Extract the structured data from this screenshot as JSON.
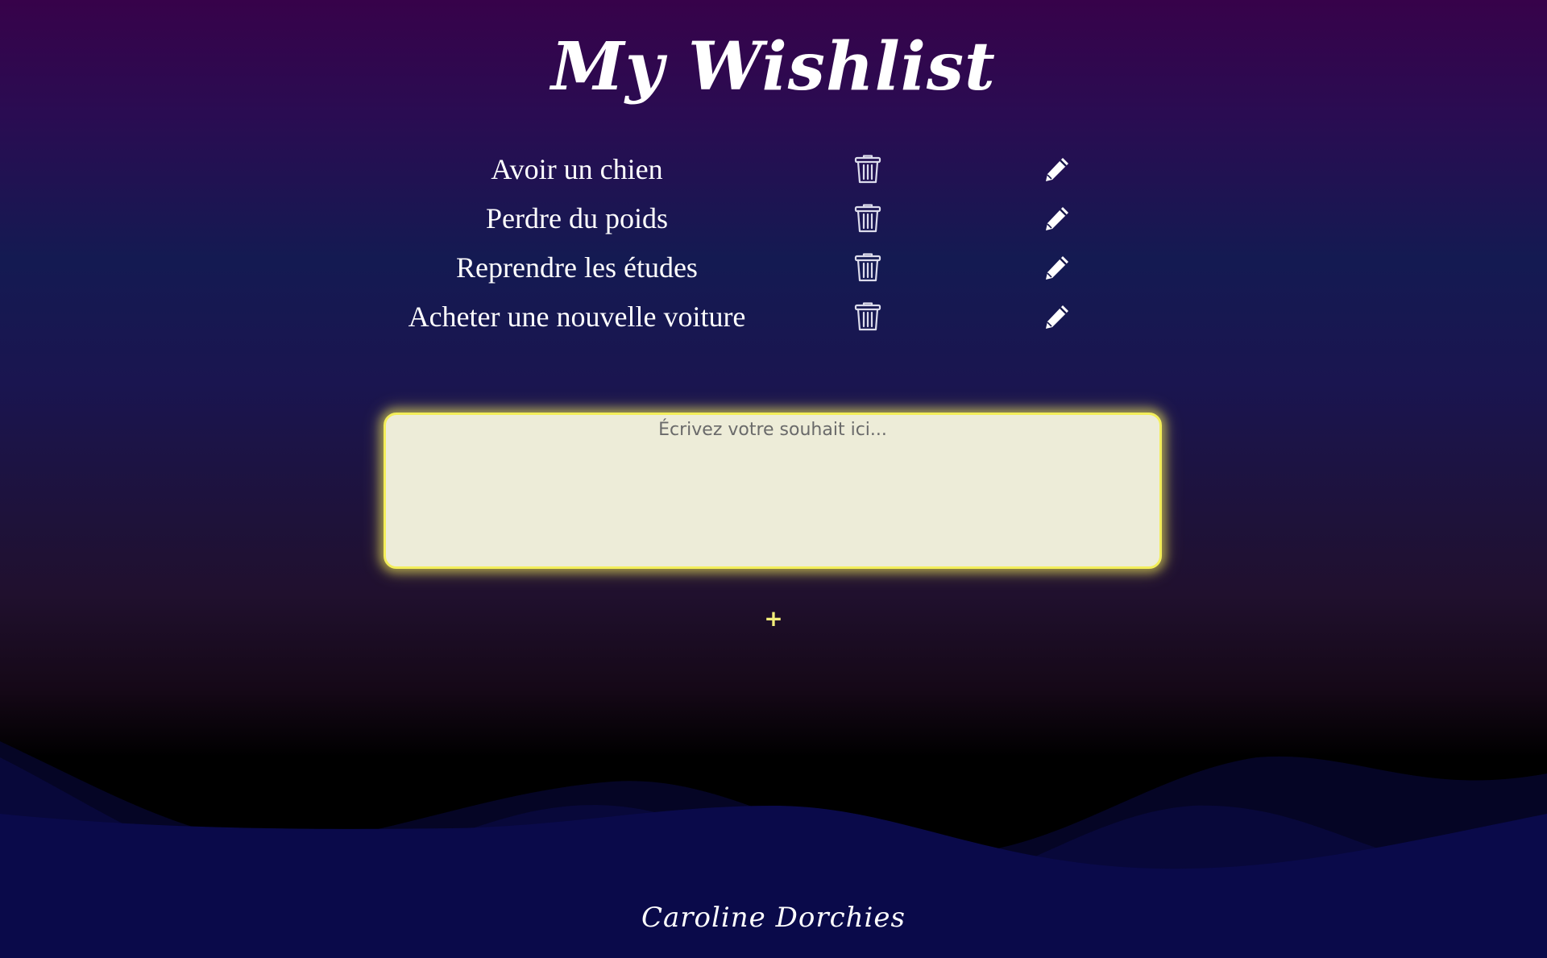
{
  "header": {
    "title": "My Wishlist"
  },
  "wishes": [
    {
      "text": "Avoir un chien",
      "delete_icon": "trash-icon",
      "edit_icon": "pencil-icon"
    },
    {
      "text": "Perdre du poids",
      "delete_icon": "trash-icon",
      "edit_icon": "pencil-icon"
    },
    {
      "text": "Reprendre les études",
      "delete_icon": "trash-icon",
      "edit_icon": "pencil-icon"
    },
    {
      "text": "Acheter une nouvelle voiture",
      "delete_icon": "trash-icon",
      "edit_icon": "pencil-icon"
    }
  ],
  "input": {
    "placeholder": "Écrivez votre souhait ici...",
    "value": ""
  },
  "add_button": {
    "label": "+"
  },
  "footer": {
    "signature": "Caroline Dorchies"
  },
  "colors": {
    "background_top": "#37024a",
    "background_mid": "#141a52",
    "background_bottom": "#000000",
    "wave_color": "#0a0a4a",
    "input_background": "#edecd8",
    "input_glow": "#f3ee5a",
    "text": "#ffffff",
    "add_button": "#f3ee7a"
  }
}
